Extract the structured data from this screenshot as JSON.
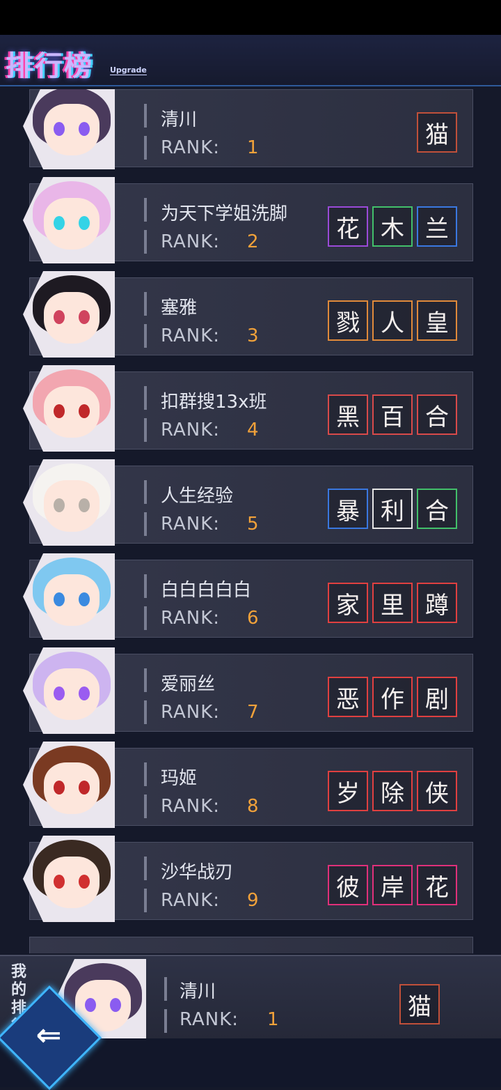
{
  "header": {
    "title": "排行榜",
    "subtitle": "Upgrade"
  },
  "colors": {
    "rank": "#f2a23a",
    "accent": "#3fb6ff"
  },
  "entries": [
    {
      "name": "清川",
      "rank_label": "RANK:",
      "rank": "1",
      "hair": "#4a3a5c",
      "eye": "#8a5cf0",
      "titles": [
        {
          "char": "猫",
          "border": "#c0503a"
        }
      ]
    },
    {
      "name": "为天下学姐洗脚",
      "rank_label": "RANK:",
      "rank": "2",
      "hair": "#e9b6e8",
      "eye": "#34d3e6",
      "titles": [
        {
          "char": "花",
          "border": "#9a4ad8"
        },
        {
          "char": "木",
          "border": "#42c06a"
        },
        {
          "char": "兰",
          "border": "#3a78e0"
        }
      ]
    },
    {
      "name": "塞雅",
      "rank_label": "RANK:",
      "rank": "3",
      "hair": "#1e1a22",
      "eye": "#d0435e",
      "titles": [
        {
          "char": "戮",
          "border": "#e08a3a"
        },
        {
          "char": "人",
          "border": "#e08a3a"
        },
        {
          "char": "皇",
          "border": "#e08a3a"
        }
      ]
    },
    {
      "name": "扣群搜13x班",
      "rank_label": "RANK:",
      "rank": "4",
      "hair": "#f2a6b0",
      "eye": "#c0282a",
      "titles": [
        {
          "char": "黑",
          "border": "#d84a4a"
        },
        {
          "char": "百",
          "border": "#d84a4a"
        },
        {
          "char": "合",
          "border": "#d84a4a"
        }
      ]
    },
    {
      "name": "人生经验",
      "rank_label": "RANK:",
      "rank": "5",
      "hair": "#f5f3f0",
      "eye": "#b8b0a8",
      "titles": [
        {
          "char": "暴",
          "border": "#3a78e0"
        },
        {
          "char": "利",
          "border": "#e6e6e6"
        },
        {
          "char": "合",
          "border": "#42c06a"
        }
      ]
    },
    {
      "name": "白白白白白",
      "rank_label": "RANK:",
      "rank": "6",
      "hair": "#7fc8f0",
      "eye": "#3a8ae0",
      "titles": [
        {
          "char": "家",
          "border": "#e04040"
        },
        {
          "char": "里",
          "border": "#e04040"
        },
        {
          "char": "蹲",
          "border": "#e04040"
        }
      ]
    },
    {
      "name": "爱丽丝",
      "rank_label": "RANK:",
      "rank": "7",
      "hair": "#cdb4f0",
      "eye": "#9a5cf0",
      "titles": [
        {
          "char": "恶",
          "border": "#e04040"
        },
        {
          "char": "作",
          "border": "#e04040"
        },
        {
          "char": "剧",
          "border": "#e04040"
        }
      ]
    },
    {
      "name": "玛姬",
      "rank_label": "RANK:",
      "rank": "8",
      "hair": "#7a3a22",
      "eye": "#c0282a",
      "titles": [
        {
          "char": "岁",
          "border": "#e04040"
        },
        {
          "char": "除",
          "border": "#e04040"
        },
        {
          "char": "侠",
          "border": "#e04040"
        }
      ]
    },
    {
      "name": "沙华战刃",
      "rank_label": "RANK:",
      "rank": "9",
      "hair": "#3a2a22",
      "eye": "#d03030",
      "titles": [
        {
          "char": "彼",
          "border": "#e0307a"
        },
        {
          "char": "岸",
          "border": "#e0307a"
        },
        {
          "char": "花",
          "border": "#e0307a"
        }
      ]
    }
  ],
  "my_rank": {
    "label": "我的排行",
    "name": "清川",
    "rank_label": "RANK:",
    "rank": "1",
    "hair": "#4a3a5c",
    "eye": "#8a5cf0",
    "titles": [
      {
        "char": "猫",
        "border": "#c0503a"
      }
    ]
  },
  "back_button": {
    "icon": "back-arrow-icon",
    "glyph": "⇐"
  }
}
